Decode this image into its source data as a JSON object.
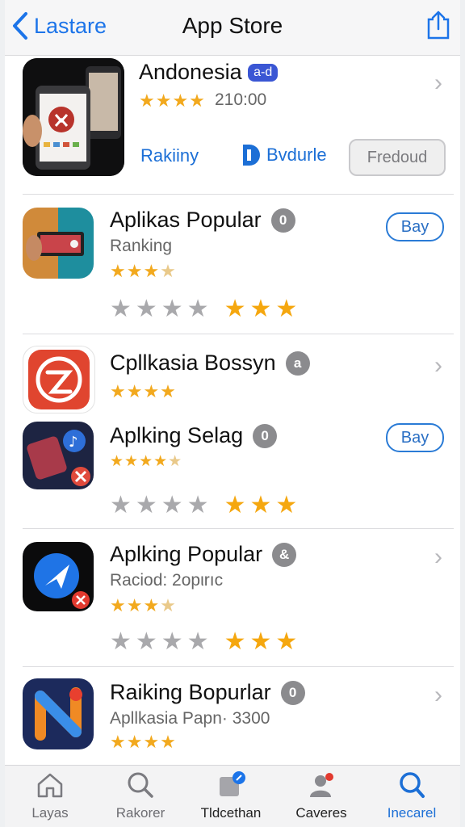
{
  "header": {
    "back_label": "Lastare",
    "title": "App Store",
    "share_icon": "share-icon",
    "accent": "#1c74e9"
  },
  "featured": {
    "title": "Andonesia",
    "badge": "a-d",
    "stars": "★★★★",
    "count": "210:00",
    "link_ranking": "Rakiiny",
    "link_bundle": "Bvdurle",
    "button": "Fredoud"
  },
  "apps": [
    {
      "title": "Aplikas Popular",
      "badge": "0",
      "subtitle": "Ranking",
      "stars": "★★★",
      "half": "★",
      "action": "Bay",
      "rating_grey": "★★★★",
      "rating_gold": "★★★"
    },
    {
      "title": "Cpllkasia Bossyn",
      "badge": "a",
      "stars": "★★★★",
      "action": "chevron"
    },
    {
      "title": "Aplking Selag",
      "badge": "0",
      "stars": "★★★★",
      "half": "★",
      "action": "Bay",
      "rating_grey": "★★★★",
      "rating_gold": "★★★"
    },
    {
      "title": "Aplking Popular",
      "badge": "&",
      "subtitle": "Raciod: 2opιrıc",
      "stars": "★★★",
      "half": "★",
      "action": "chevron",
      "rating_grey": "★★★★",
      "rating_gold": "★★★"
    },
    {
      "title": "Raiking Bopurlar",
      "badge": "0",
      "subtitle": "Apllkasia Papn· 3300",
      "stars": "★★★★",
      "action": "chevron"
    }
  ],
  "tabs": [
    {
      "label": "Layas",
      "icon": "home-icon"
    },
    {
      "label": "Rakorer",
      "icon": "search-icon"
    },
    {
      "label": "Tldcethan",
      "icon": "apps-icon"
    },
    {
      "label": "Caveres",
      "icon": "person-icon"
    },
    {
      "label": "Inecarel",
      "icon": "search-icon",
      "active": true
    }
  ],
  "chevron_glyph": "›"
}
